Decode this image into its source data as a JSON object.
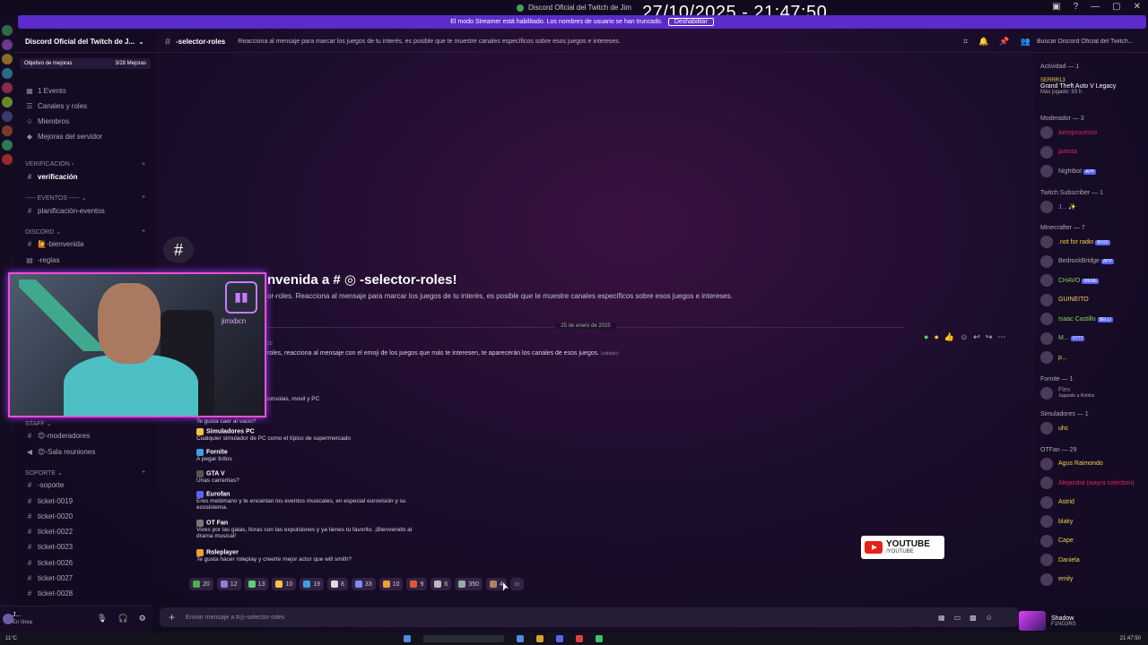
{
  "window": {
    "title": "Discord Oficial del Twitch de Jim",
    "clock": "27/10/2025 - 21:47:50"
  },
  "streamer_banner": {
    "text": "El modo Streamer está habilitado. Los nombres de usuario se han truncado.",
    "button": "Deshabilitar"
  },
  "server": {
    "name": "Discord Oficial del Twitch de J...",
    "boost_label": "Objetivo de mejoras",
    "boost_count": "3/28 Mejoras"
  },
  "sidebar": {
    "top_items": [
      {
        "label": "1 Evento",
        "icon": "calendar-icon"
      },
      {
        "label": "Canales y roles",
        "icon": "list-icon"
      },
      {
        "label": "Miembros",
        "icon": "members-icon"
      },
      {
        "label": "Mejoras del servidor",
        "icon": "boost-icon"
      }
    ],
    "categories": {
      "verificacion": "VERIFICACIÓN",
      "eventos": "----- Eventos -----",
      "discord": "DISCORD",
      "staff": "Staff",
      "soporte": "Soporte"
    },
    "channels": {
      "verificacion": "verificación",
      "planificacion": "planificación-eventos",
      "bienvenida": "🙋-bienvenida",
      "reglas": "-reglas",
      "moderadores": "😊-moderadores",
      "sala": "😊-Sala reuniones",
      "soporte": "-soporte",
      "tickets": [
        "ticket-0019",
        "ticket-0020",
        "ticket-0022",
        "ticket-0023",
        "ticket-0026",
        "ticket-0027",
        "ticket-0028"
      ]
    }
  },
  "user_panel": {
    "name": "J...",
    "status": "En línea"
  },
  "channel": {
    "name": "-selector-roles",
    "topic": "Reacciona al mensaje para marcar los juegos de tu interés, es posible que te muestre canales específicos sobre esos juegos e intereses.",
    "search_placeholder": "Buscar Discord Oficial del Twitch..."
  },
  "welcome": {
    "title": "nvenida a # ◎ -selector-roles!",
    "subtitle": "or-roles. Reacciona al mensaje para marcar los juegos de tu interés, es posible que te muestre canales específicos sobre esos juegos e intereses."
  },
  "message": {
    "date": "25 de enero de 2025",
    "time": "20",
    "text": "roles, reacciona al mensaje con el emoji de los juegos que más te interesen, te aparecerán los canales de esos juegos.",
    "edited": "(editado)",
    "fragment1": "consolas, movil y PC",
    "fragment2": "Te gusta caer al vacio?",
    "options": [
      {
        "title": "Simuladores PC",
        "desc": "Cualquier simulador de PC como el típico de supermercado",
        "color": "#f5c542"
      },
      {
        "title": "Fornite",
        "desc": "A pegar tiritos",
        "color": "#3ba0e6"
      },
      {
        "title": "GTA V",
        "desc": "Unas carreritas?",
        "color": "#555"
      },
      {
        "title": "Eurofan",
        "desc": "Eres melómano y te encantan los eventos musicales, en especial eurovisión y su ecosistema.",
        "color": "#5865f2"
      },
      {
        "title": "OT Fan",
        "desc": "Vives por las galas, lloras con las expulsiones y ya tienes tu favorito. ¡Bienvenido al drama musical!",
        "color": "#777"
      },
      {
        "title": "Roleplayer",
        "desc": "Te gusta hacer roleplay y creerte mejor actor que will smith?",
        "color": "#f0a030"
      }
    ],
    "reactions": [
      {
        "count": "20",
        "color": "#4caf50"
      },
      {
        "count": "12",
        "color": "#9c7ad8"
      },
      {
        "count": "13",
        "color": "#5bd36a"
      },
      {
        "count": "10",
        "color": "#f5c542"
      },
      {
        "count": "19",
        "color": "#3ba0e6"
      },
      {
        "count": "8",
        "color": "#ddd"
      },
      {
        "count": "33",
        "color": "#7a8cff"
      },
      {
        "count": "10",
        "color": "#f0a030"
      },
      {
        "count": "9",
        "color": "#e05a30"
      },
      {
        "count": "6",
        "color": "#bbb"
      },
      {
        "count": "350",
        "color": "#9aa"
      },
      {
        "count": "4",
        "color": "#b08060"
      }
    ]
  },
  "input": {
    "placeholder": "Enviar mensaje a #◎-selector-roles"
  },
  "webcam": {
    "channel": "jimxbcn"
  },
  "yt_badge": {
    "line1": "YOUTUBE",
    "line2": "/YOUTUBE"
  },
  "members": {
    "activity_header": "Actividad — 1",
    "activity": {
      "user": "SERRR13",
      "game": "Grand Theft Auto V Legacy",
      "played": "Más jugado: 93 h"
    },
    "groups": [
      {
        "header": "Moderador — 3",
        "members": [
          {
            "name": "Aeroprocesso",
            "color": "#e0245e"
          },
          {
            "name": "jamsta",
            "color": "#e0245e"
          },
          {
            "name": "Nightbot",
            "color": "#aaa",
            "tag": "APP"
          }
        ]
      },
      {
        "header": "Twitch Subscriber — 1",
        "members": [
          {
            "name": "J... ✨",
            "color": "#9b7cff"
          }
        ]
      },
      {
        "header": "Minecrafter — 7",
        "members": [
          {
            "name": ".not for radio",
            "color": "#f4d24a",
            "tag": "BOOI"
          },
          {
            "name": "BedrockBridge",
            "color": "#aaa",
            "tag": "APP"
          },
          {
            "name": "CHAVO",
            "color": "#7ed957",
            "tag": "MEME"
          },
          {
            "name": "GUINEITO",
            "color": "#f4d24a"
          },
          {
            "name": "Isaac Castillo",
            "color": "#7ed957",
            "tag": "BELU"
          },
          {
            "name": "M...",
            "color": "#7ed957",
            "tag": "V777"
          },
          {
            "name": "p...",
            "color": "#f4d24a"
          }
        ]
      },
      {
        "header": "Fornite — 1",
        "members": [
          {
            "name": "Flex",
            "color": "#888",
            "sub": "Jugando a Roblox"
          }
        ]
      },
      {
        "header": "Simuladores — 1",
        "members": [
          {
            "name": "uhc",
            "color": "#f4d24a"
          }
        ]
      },
      {
        "header": "OTFan — 29",
        "members": [
          {
            "name": "Agus Raimondo",
            "color": "#f4d24a"
          },
          {
            "name": "Alejandra (wayra colection)",
            "color": "#e0245e"
          },
          {
            "name": "Astrid",
            "color": "#f4d24a"
          },
          {
            "name": "blaky",
            "color": "#f4d24a"
          },
          {
            "name": "Cape",
            "color": "#f4d24a"
          },
          {
            "name": "Daniela",
            "color": "#f4d24a"
          },
          {
            "name": "emily",
            "color": "#f4d24a"
          }
        ]
      }
    ]
  },
  "stream_card": {
    "name": "Shadow",
    "sub": "F1NG3RS"
  },
  "taskbar": {
    "weather": "11°C",
    "time": "21:47:50"
  }
}
